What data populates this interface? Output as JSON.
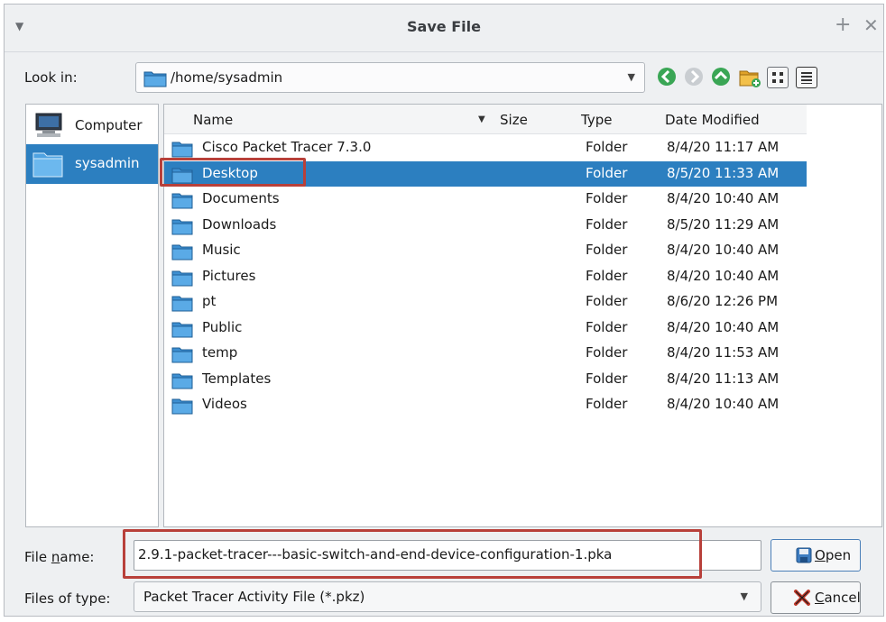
{
  "window": {
    "title": "Save File",
    "menu_icon": "chevron-down-icon",
    "plus_icon": "plus-icon",
    "close_icon": "close-icon"
  },
  "look_in": {
    "label": "Look in:",
    "path": "/home/sysadmin",
    "nav_icons": [
      "back-icon",
      "forward-icon",
      "up-icon",
      "new-folder-icon",
      "icon-view-icon",
      "list-view-icon"
    ]
  },
  "places": [
    {
      "label": "Computer",
      "icon": "computer-icon",
      "selected": false
    },
    {
      "label": "sysadmin",
      "icon": "folder-icon",
      "selected": true
    }
  ],
  "table": {
    "columns": [
      "Name",
      "Size",
      "Type",
      "Date Modified"
    ],
    "rows": [
      {
        "name": "Cisco Packet Tracer 7.3.0",
        "type": "Folder",
        "date": "8/4/20 11:17 AM"
      },
      {
        "name": "Desktop",
        "type": "Folder",
        "date": "8/5/20 11:33 AM",
        "selected": true
      },
      {
        "name": "Documents",
        "type": "Folder",
        "date": "8/4/20 10:40 AM"
      },
      {
        "name": "Downloads",
        "type": "Folder",
        "date": "8/5/20 11:29 AM"
      },
      {
        "name": "Music",
        "type": "Folder",
        "date": "8/4/20 10:40 AM"
      },
      {
        "name": "Pictures",
        "type": "Folder",
        "date": "8/4/20 10:40 AM"
      },
      {
        "name": "pt",
        "type": "Folder",
        "date": "8/6/20 12:26 PM"
      },
      {
        "name": "Public",
        "type": "Folder",
        "date": "8/4/20 10:40 AM"
      },
      {
        "name": "temp",
        "type": "Folder",
        "date": "8/4/20 11:53 AM"
      },
      {
        "name": "Templates",
        "type": "Folder",
        "date": "8/4/20 11:13 AM"
      },
      {
        "name": "Videos",
        "type": "Folder",
        "date": "8/4/20 10:40 AM"
      }
    ]
  },
  "file_name": {
    "label_pre": "File ",
    "label_ul": "n",
    "label_post": "ame:",
    "value": "2.9.1-packet-tracer---basic-switch-and-end-device-configuration-1.pka"
  },
  "file_type": {
    "label": "Files of type:",
    "value": "Packet Tracer Activity File (*.pkz)"
  },
  "buttons": {
    "open_ul": "O",
    "open_rest": "pen",
    "cancel_ul": "C",
    "cancel_rest": "ancel"
  },
  "colors": {
    "selection": "#2c7fc0",
    "annotation": "#b8403a"
  }
}
